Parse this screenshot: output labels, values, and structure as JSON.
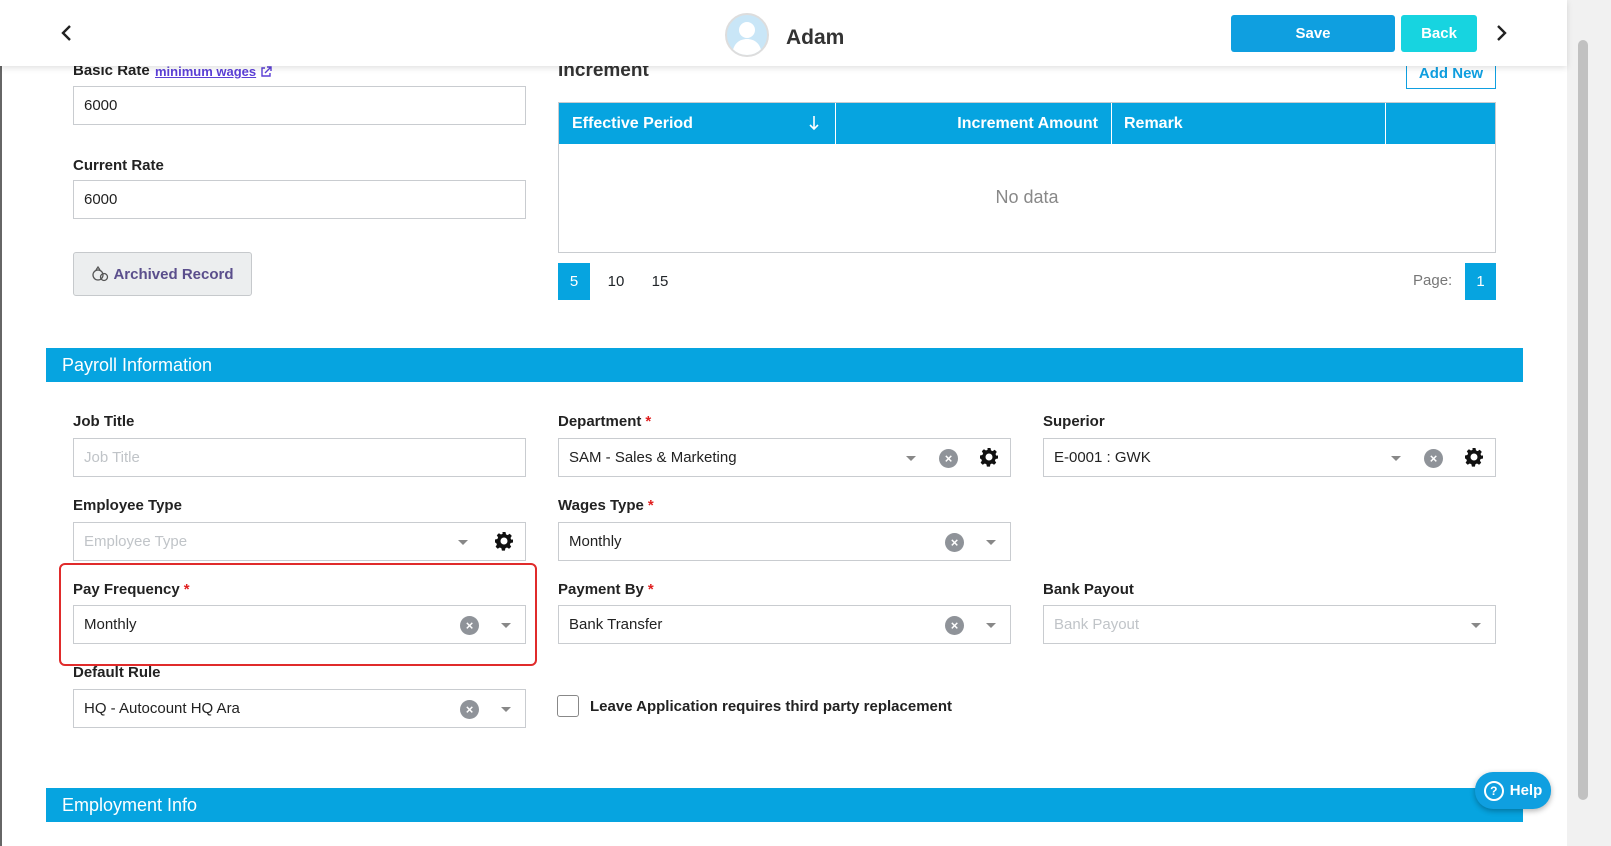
{
  "header": {
    "user_name": "Adam",
    "save_label": "Save",
    "back_label": "Back"
  },
  "rates": {
    "basic_rate_label": "Basic Rate",
    "minimum_wages_link": "minimum wages",
    "basic_rate_value": "6000",
    "current_rate_label": "Current Rate",
    "current_rate_value": "6000",
    "archived_record_label": "Archived Record"
  },
  "increment": {
    "title": "Increment",
    "add_new_label": "Add New",
    "columns": [
      "Effective Period",
      "Increment Amount",
      "Remark"
    ],
    "empty_text": "No data",
    "page_sizes": [
      "5",
      "10",
      "15"
    ],
    "active_page_size": "5",
    "page_label": "Page:",
    "current_page": "1"
  },
  "payroll": {
    "section_title": "Payroll Information",
    "job_title": {
      "label": "Job Title",
      "placeholder": "Job Title"
    },
    "department": {
      "label": "Department",
      "value": "SAM - Sales & Marketing"
    },
    "superior": {
      "label": "Superior",
      "value": "E-0001 : GWK"
    },
    "employee_type": {
      "label": "Employee Type",
      "placeholder": "Employee Type"
    },
    "wages_type": {
      "label": "Wages Type",
      "value": "Monthly"
    },
    "pay_frequency": {
      "label": "Pay Frequency",
      "value": "Monthly"
    },
    "payment_by": {
      "label": "Payment By",
      "value": "Bank Transfer"
    },
    "bank_payout": {
      "label": "Bank Payout",
      "placeholder": "Bank Payout"
    },
    "default_rule": {
      "label": "Default Rule",
      "value": "HQ - Autocount HQ Ara"
    },
    "leave_checkbox_label": "Leave Application requires third party replacement",
    "required_mark": "*"
  },
  "employment": {
    "section_title": "Employment Info"
  },
  "help_label": "Help",
  "colors": {
    "primary": "#06a4e0",
    "save": "#0f9fe0",
    "back": "#17d4e0",
    "required": "#e02020",
    "highlight": "#e02b2b"
  }
}
